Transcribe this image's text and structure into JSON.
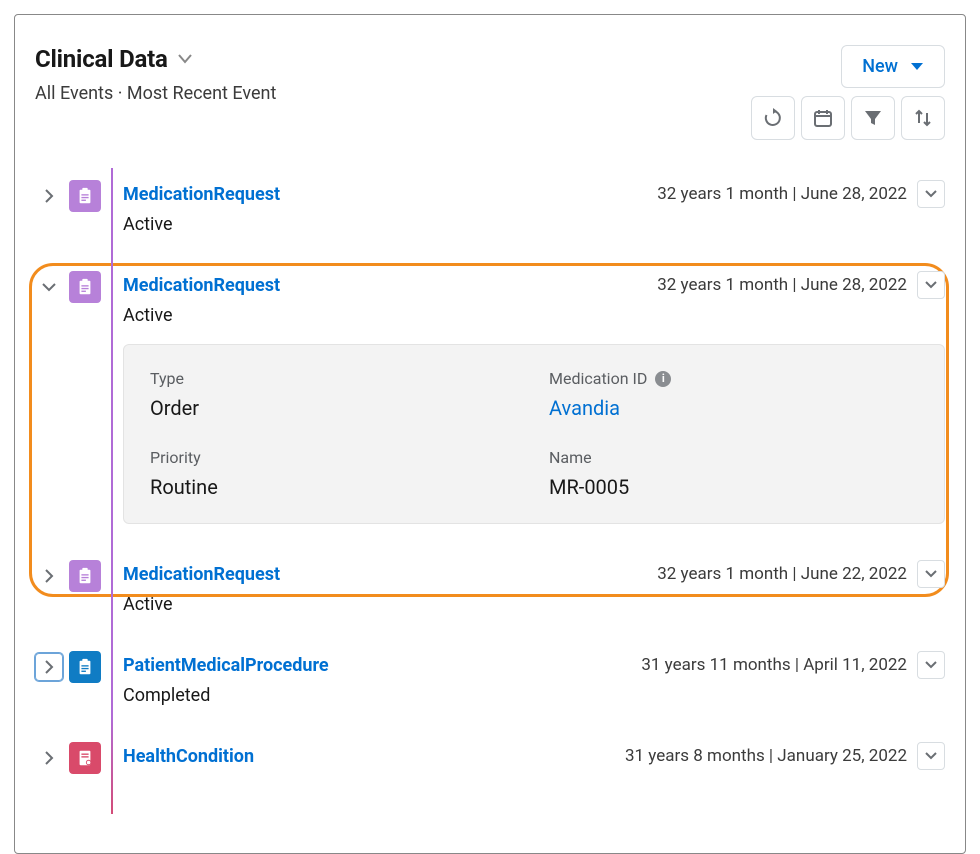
{
  "header": {
    "title": "Clinical Data",
    "subtitle": "All Events · Most Recent Event",
    "new_label": "New"
  },
  "items": [
    {
      "title": "MedicationRequest",
      "status": "Active",
      "meta": "32 years 1 month | June 28, 2022",
      "icon_color": "purple",
      "expanded": false
    },
    {
      "title": "MedicationRequest",
      "status": "Active",
      "meta": "32 years 1 month | June 28, 2022",
      "icon_color": "purple",
      "expanded": true,
      "details": {
        "type_label": "Type",
        "type_value": "Order",
        "med_id_label": "Medication ID",
        "med_id_value": "Avandia",
        "priority_label": "Priority",
        "priority_value": "Routine",
        "name_label": "Name",
        "name_value": "MR-0005"
      }
    },
    {
      "title": "MedicationRequest",
      "status": "Active",
      "meta": "32 years 1 month | June 22, 2022",
      "icon_color": "purple",
      "expanded": false
    },
    {
      "title": "PatientMedicalProcedure",
      "status": "Completed",
      "meta": "31 years 11 months | April 11, 2022",
      "icon_color": "blue",
      "expanded": false,
      "focused": true
    },
    {
      "title": "HealthCondition",
      "status": "",
      "meta": "31 years 8 months | January 25, 2022",
      "icon_color": "pink",
      "expanded": false
    }
  ]
}
